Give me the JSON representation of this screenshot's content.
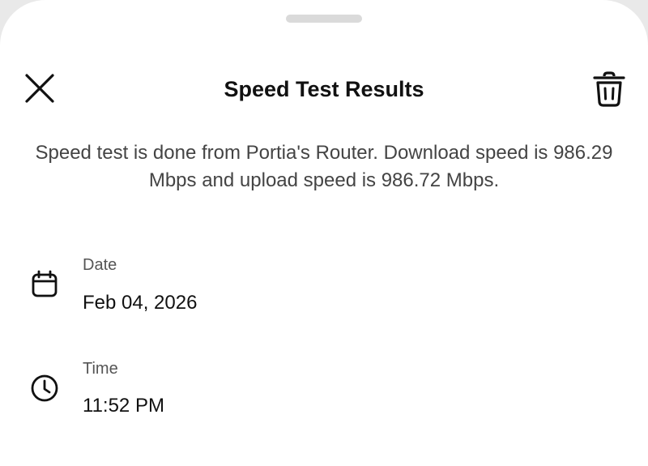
{
  "sheet": {
    "title": "Speed Test Results",
    "description": "Speed test is done from Portia's Router. Download speed is 986.29 Mbps and upload speed is 986.72 Mbps."
  },
  "icons": {
    "close": "close-icon",
    "delete": "trash-icon",
    "date": "calendar-icon",
    "time": "clock-icon"
  },
  "details": {
    "date": {
      "label": "Date",
      "value": "Feb 04, 2026"
    },
    "time": {
      "label": "Time",
      "value": "11:52 PM"
    }
  },
  "colors": {
    "background": "#ffffff",
    "text_primary": "#111111",
    "text_secondary": "#444444",
    "handle": "#dadada"
  }
}
